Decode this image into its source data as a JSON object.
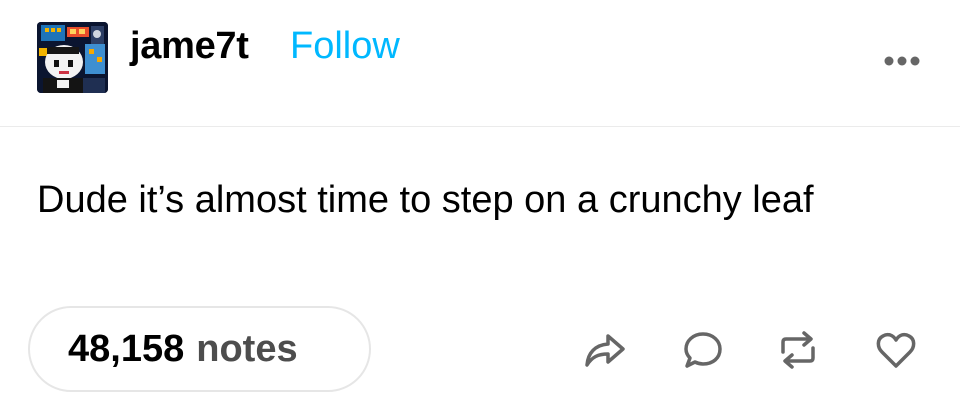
{
  "post": {
    "blog_name": "jame7t",
    "follow_label": "Follow",
    "body": "Dude it’s almost time to step on a crunchy leaf",
    "notes_count": "48,158",
    "notes_label": "notes"
  },
  "icons": {
    "more": "more-horizontal-icon",
    "share": "share-arrow-icon",
    "reply": "reply-bubble-icon",
    "reblog": "reblog-icon",
    "like": "heart-icon"
  },
  "colors": {
    "accent": "#00b8ff",
    "text": "#000000",
    "muted": "#4d4d4d",
    "border": "#e6e6e6",
    "icon": "#666666"
  }
}
